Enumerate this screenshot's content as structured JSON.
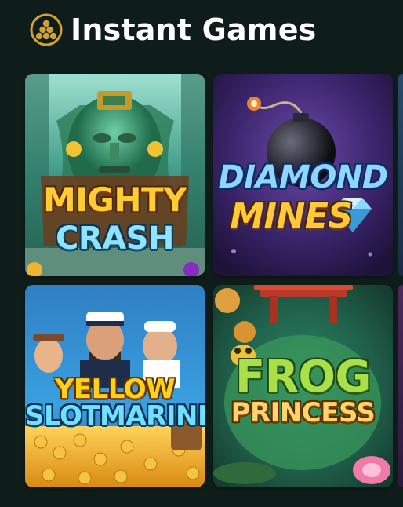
{
  "header": {
    "title": "Instant Games",
    "icon": "billiard-balls-icon"
  },
  "games": [
    {
      "title_line1": "Mighty",
      "title_line2": "Crash"
    },
    {
      "title_line1": "Diamond",
      "title_line2": "Mines"
    },
    {
      "title_line1": "Yellow",
      "title_line2": "Slotmarine"
    },
    {
      "title_line1": "Frog",
      "title_line2": "Princess"
    }
  ],
  "colors": {
    "background": "#0f1d1a",
    "accent_gold": "#d4a230",
    "title_text": "#ffffff"
  }
}
